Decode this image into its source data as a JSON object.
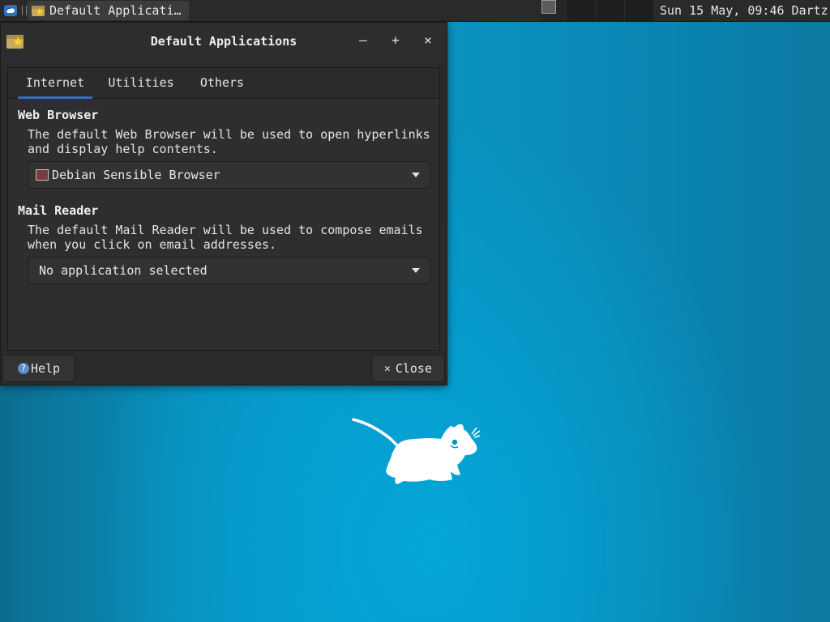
{
  "panel": {
    "taskbar_item_label": "Default Applicati…",
    "clock": "Sun 15 May, 09:46  Dartz"
  },
  "window": {
    "title": "Default Applications",
    "controls": {
      "minimize": "–",
      "maximize": "+",
      "close": "×"
    },
    "tabs": [
      {
        "label": "Internet",
        "active": true
      },
      {
        "label": "Utilities",
        "active": false
      },
      {
        "label": "Others",
        "active": false
      }
    ],
    "web_browser": {
      "heading": "Web Browser",
      "description_line1": "The default Web Browser will be used to open hyperlinks",
      "description_line2": "and display help contents.",
      "selected": "Debian Sensible Browser"
    },
    "mail_reader": {
      "heading": "Mail Reader",
      "description_line1": "The default Mail Reader will be used to compose emails",
      "description_line2": "when you click on email addresses.",
      "selected": "No application selected"
    },
    "buttons": {
      "help": "Help",
      "close": "Close"
    }
  },
  "icons": {
    "panel_menu": "xfce-mouse-icon",
    "taskbar_app": "preferred-applications-icon",
    "window_app": "preferred-applications-icon",
    "browser": "browser-icon",
    "help": "help-icon",
    "close": "close-icon"
  },
  "colors": {
    "desktop": "#0a8fbf",
    "panel": "#2a2a2a",
    "window": "#2b2b2b",
    "tab_accent": "#2f6fbf"
  }
}
